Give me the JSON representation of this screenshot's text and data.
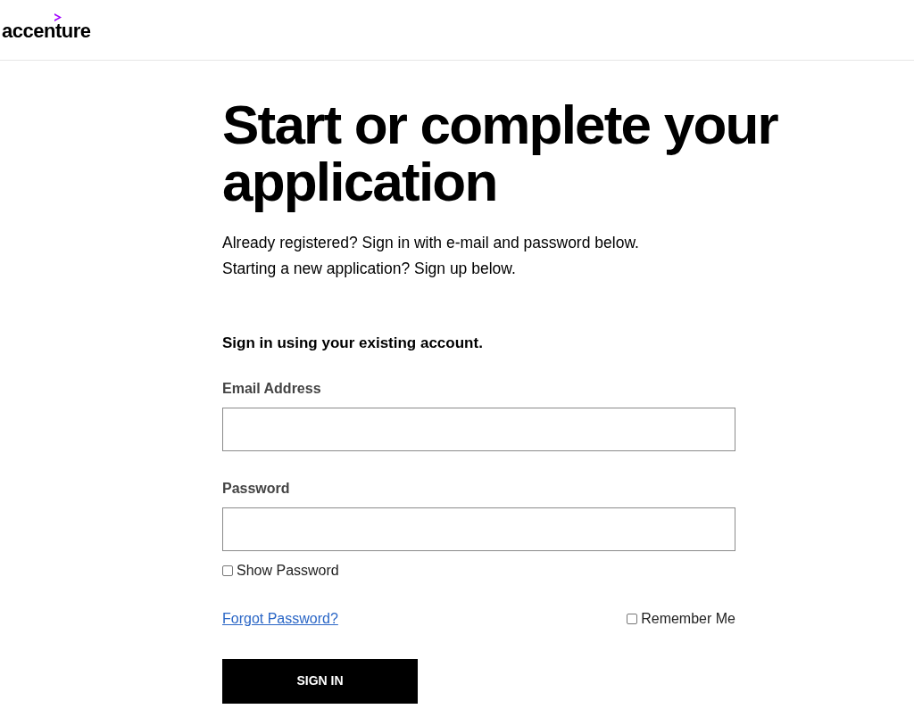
{
  "header": {
    "logo_text": "accenture"
  },
  "title": "Start or complete your application",
  "intro": [
    "Already registered? Sign in with e-mail and password below.",
    "Starting a new application? Sign up below."
  ],
  "form": {
    "heading": "Sign in using your existing account.",
    "fields": [
      {
        "label": "Email Address"
      },
      {
        "label": "Password"
      }
    ],
    "show_password": {
      "label": "Show Password",
      "checked": false
    },
    "forgot_link": "Forgot Password?",
    "remember_me": {
      "label": "Remember Me",
      "checked": false
    },
    "submit": "SIGN IN"
  }
}
